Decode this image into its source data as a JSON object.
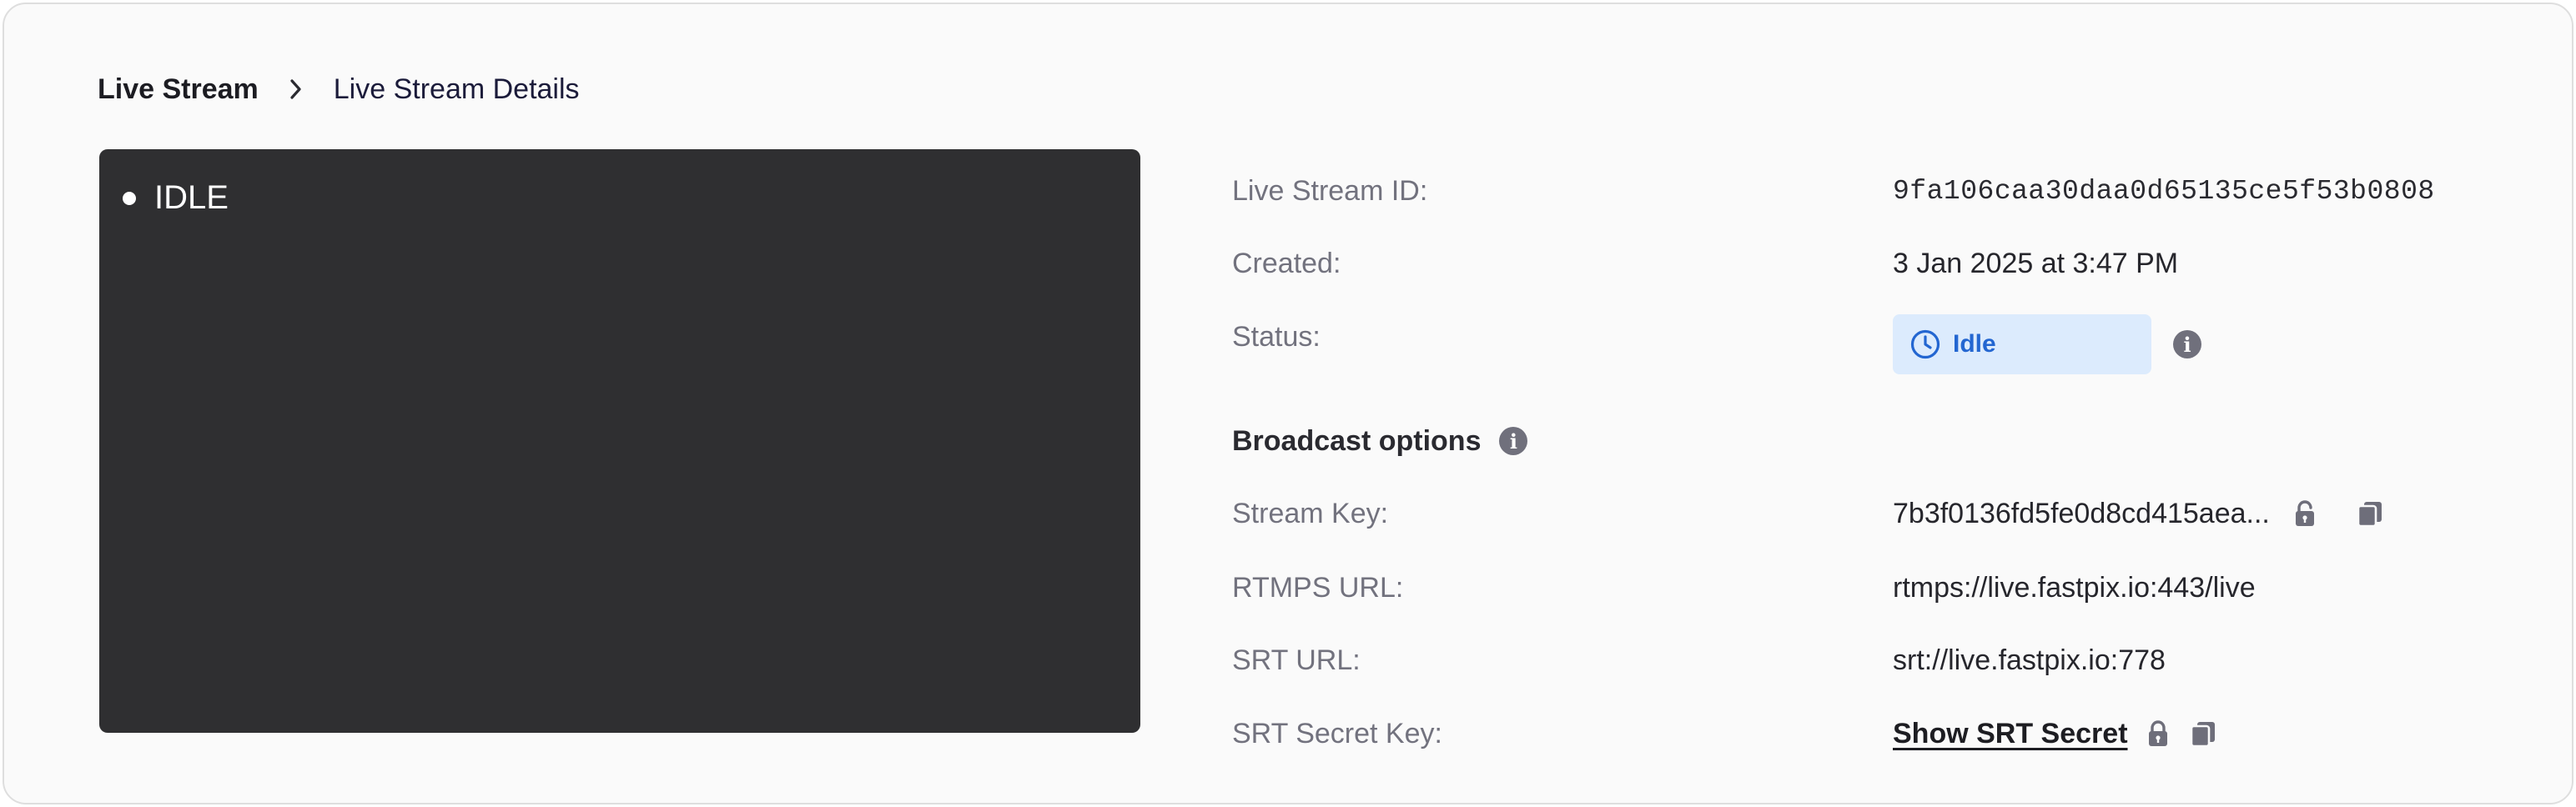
{
  "breadcrumb": {
    "root": "Live Stream",
    "current": "Live Stream Details"
  },
  "player": {
    "status_label": "IDLE"
  },
  "details": {
    "live_stream_id": {
      "label": "Live Stream ID:",
      "value": "9fa106caa30daa0d65135ce5f53b0808"
    },
    "created": {
      "label": "Created:",
      "value": "3 Jan 2025 at 3:47 PM"
    },
    "status": {
      "label": "Status:",
      "value": "Idle",
      "badge_color": "#dcebfd",
      "text_color": "#2366d1"
    }
  },
  "broadcast": {
    "title": "Broadcast options",
    "stream_key": {
      "label": "Stream Key:",
      "value": "7b3f0136fd5fe0d8cd415aea..."
    },
    "rtmps_url": {
      "label": "RTMPS URL:",
      "value": "rtmps://live.fastpix.io:443/live"
    },
    "srt_url": {
      "label": "SRT URL:",
      "value": "srt://live.fastpix.io:778"
    },
    "srt_secret": {
      "label": "SRT Secret Key:",
      "value": "Show SRT Secret"
    }
  },
  "icons": {
    "breadcrumb_separator": "chevron-right-icon",
    "status": "clock-icon",
    "info": "info-icon",
    "lock": "lock-icon",
    "copy": "copy-icon"
  }
}
